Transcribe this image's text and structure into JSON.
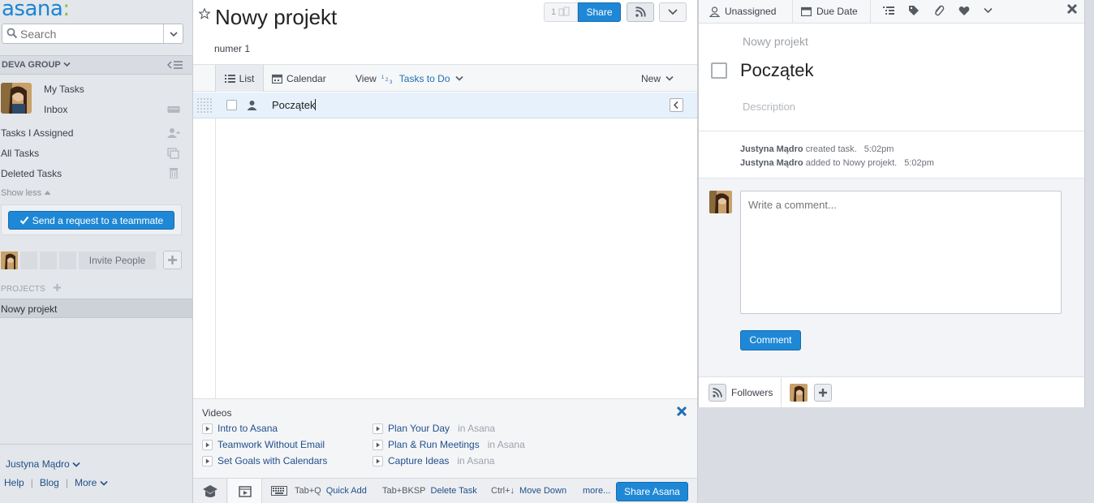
{
  "brand": {
    "name": "asana",
    "accent": "#1f88d6"
  },
  "sidebar": {
    "search_placeholder": "Search",
    "workspace": "DEVA GROUP",
    "nav": [
      {
        "label": "My Tasks"
      },
      {
        "label": "Inbox"
      },
      {
        "label": "Tasks I Assigned"
      },
      {
        "label": "All Tasks"
      },
      {
        "label": "Deleted Tasks"
      }
    ],
    "show_less": "Show less",
    "request_button": "Send a request to a teammate",
    "invite_people": "Invite People",
    "projects_header": "PROJECTS",
    "projects": [
      "Nowy projekt"
    ],
    "user_name": "Justyna Mądro",
    "footer_links": [
      "Help",
      "Blog",
      "More"
    ]
  },
  "project": {
    "title": "Nowy projekt",
    "description": "numer 1",
    "members_count": "1",
    "share_label": "Share",
    "tabs": [
      "List",
      "Calendar"
    ],
    "view_label": "View",
    "view_filter": "Tasks to Do",
    "new_label": "New"
  },
  "tasks": [
    {
      "name": "Początek"
    }
  ],
  "videos": {
    "title": "Videos",
    "items": [
      {
        "label": "Intro to Asana",
        "suffix": ""
      },
      {
        "label": "Teamwork Without Email",
        "suffix": ""
      },
      {
        "label": "Set Goals with Calendars",
        "suffix": ""
      },
      {
        "label": "Plan Your Day",
        "suffix": "in Asana"
      },
      {
        "label": "Plan & Run Meetings",
        "suffix": "in Asana"
      },
      {
        "label": "Capture Ideas",
        "suffix": "in Asana"
      }
    ]
  },
  "shortcuts": {
    "items": [
      {
        "key": "Tab+Q",
        "action": "Quick Add"
      },
      {
        "key": "Tab+BKSP",
        "action": "Delete Task"
      },
      {
        "key": "Ctrl+↓",
        "action": "Move Down"
      }
    ],
    "more": "more...",
    "share_asana": "Share Asana"
  },
  "detail": {
    "assignee": "Unassigned",
    "due_date": "Due Date",
    "project": "Nowy projekt",
    "task_title": "Początek",
    "description_placeholder": "Description",
    "activity": [
      {
        "user": "Justyna Mądro",
        "text": "created task.",
        "time": "5:02pm"
      },
      {
        "user": "Justyna Mądro",
        "text": "added to Nowy projekt.",
        "time": "5:02pm"
      }
    ],
    "comment_placeholder": "Write a comment...",
    "comment_button": "Comment",
    "followers_label": "Followers"
  }
}
